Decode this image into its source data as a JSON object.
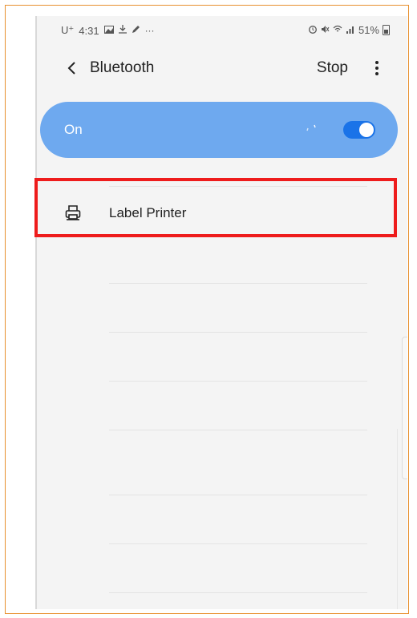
{
  "status_bar": {
    "carrier": "U⁺",
    "time": "4:31",
    "left_icons": [
      "gallery-icon",
      "download-icon",
      "pen-icon",
      "more-icon"
    ],
    "battery": "51%"
  },
  "app_bar": {
    "title": "Bluetooth",
    "action": "Stop"
  },
  "toggle": {
    "label": "On",
    "state": true
  },
  "devices": [
    {
      "name": "Label Printer",
      "icon": "printer-icon"
    }
  ],
  "colors": {
    "toggle_bg": "#6ea9ef",
    "switch_on": "#1a73e8",
    "highlight": "#ee1c1c",
    "frame": "#e8902e"
  }
}
